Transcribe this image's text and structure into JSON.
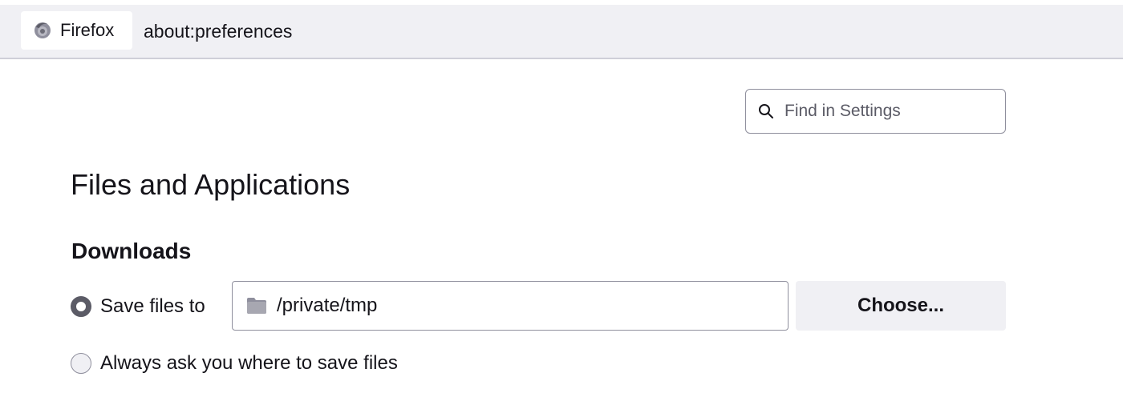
{
  "urlbar": {
    "identity_label": "Firefox",
    "identity_icon": "firefox-icon",
    "url": "about:preferences"
  },
  "search": {
    "placeholder": "Find in Settings",
    "value": "",
    "icon": "search-icon"
  },
  "page": {
    "title": "Files and Applications"
  },
  "downloads": {
    "heading": "Downloads",
    "save_to_label": "Save files to",
    "save_to_selected": true,
    "path": "/private/tmp",
    "path_icon": "folder-icon",
    "choose_label": "Choose...",
    "always_ask_label": "Always ask you where to save files",
    "always_ask_selected": false
  },
  "colors": {
    "text": "#15141a",
    "toolbar_bg": "#f0f0f4",
    "border": "#8f8f9d",
    "radio_checked": "#5b5b66",
    "button_bg": "#f0f0f4"
  }
}
